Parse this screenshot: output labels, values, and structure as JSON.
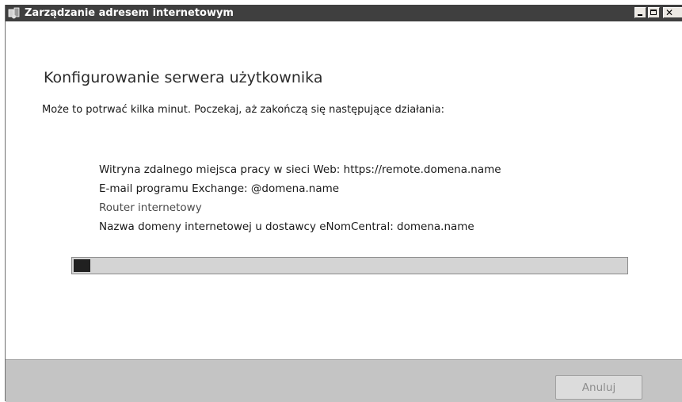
{
  "window": {
    "title": "Zarządzanie adresem internetowym",
    "controls": {
      "minimize_icon": "minimize-icon",
      "maximize_icon": "maximize-icon",
      "close_icon": "close-icon"
    }
  },
  "main": {
    "heading": "Konfigurowanie serwera użytkownika",
    "subtitle": "Może to potrwać kilka minut. Poczekaj, aż zakończą się następujące działania:",
    "tasks": [
      "Witryna zdalnego miejsca pracy w sieci Web: https://remote.domena.name",
      "E-mail programu Exchange: @domena.name",
      "Router internetowy",
      "Nazwa domeny internetowej u dostawcy eNomCentral: domena.name"
    ],
    "progress": 0.03
  },
  "footer": {
    "cancel_label": "Anuluj"
  },
  "colors": {
    "titlebar": "#3f3f3f",
    "footer": "#c4c4c4",
    "progress_fill": "#202020",
    "progress_track": "#d4d4d4"
  }
}
